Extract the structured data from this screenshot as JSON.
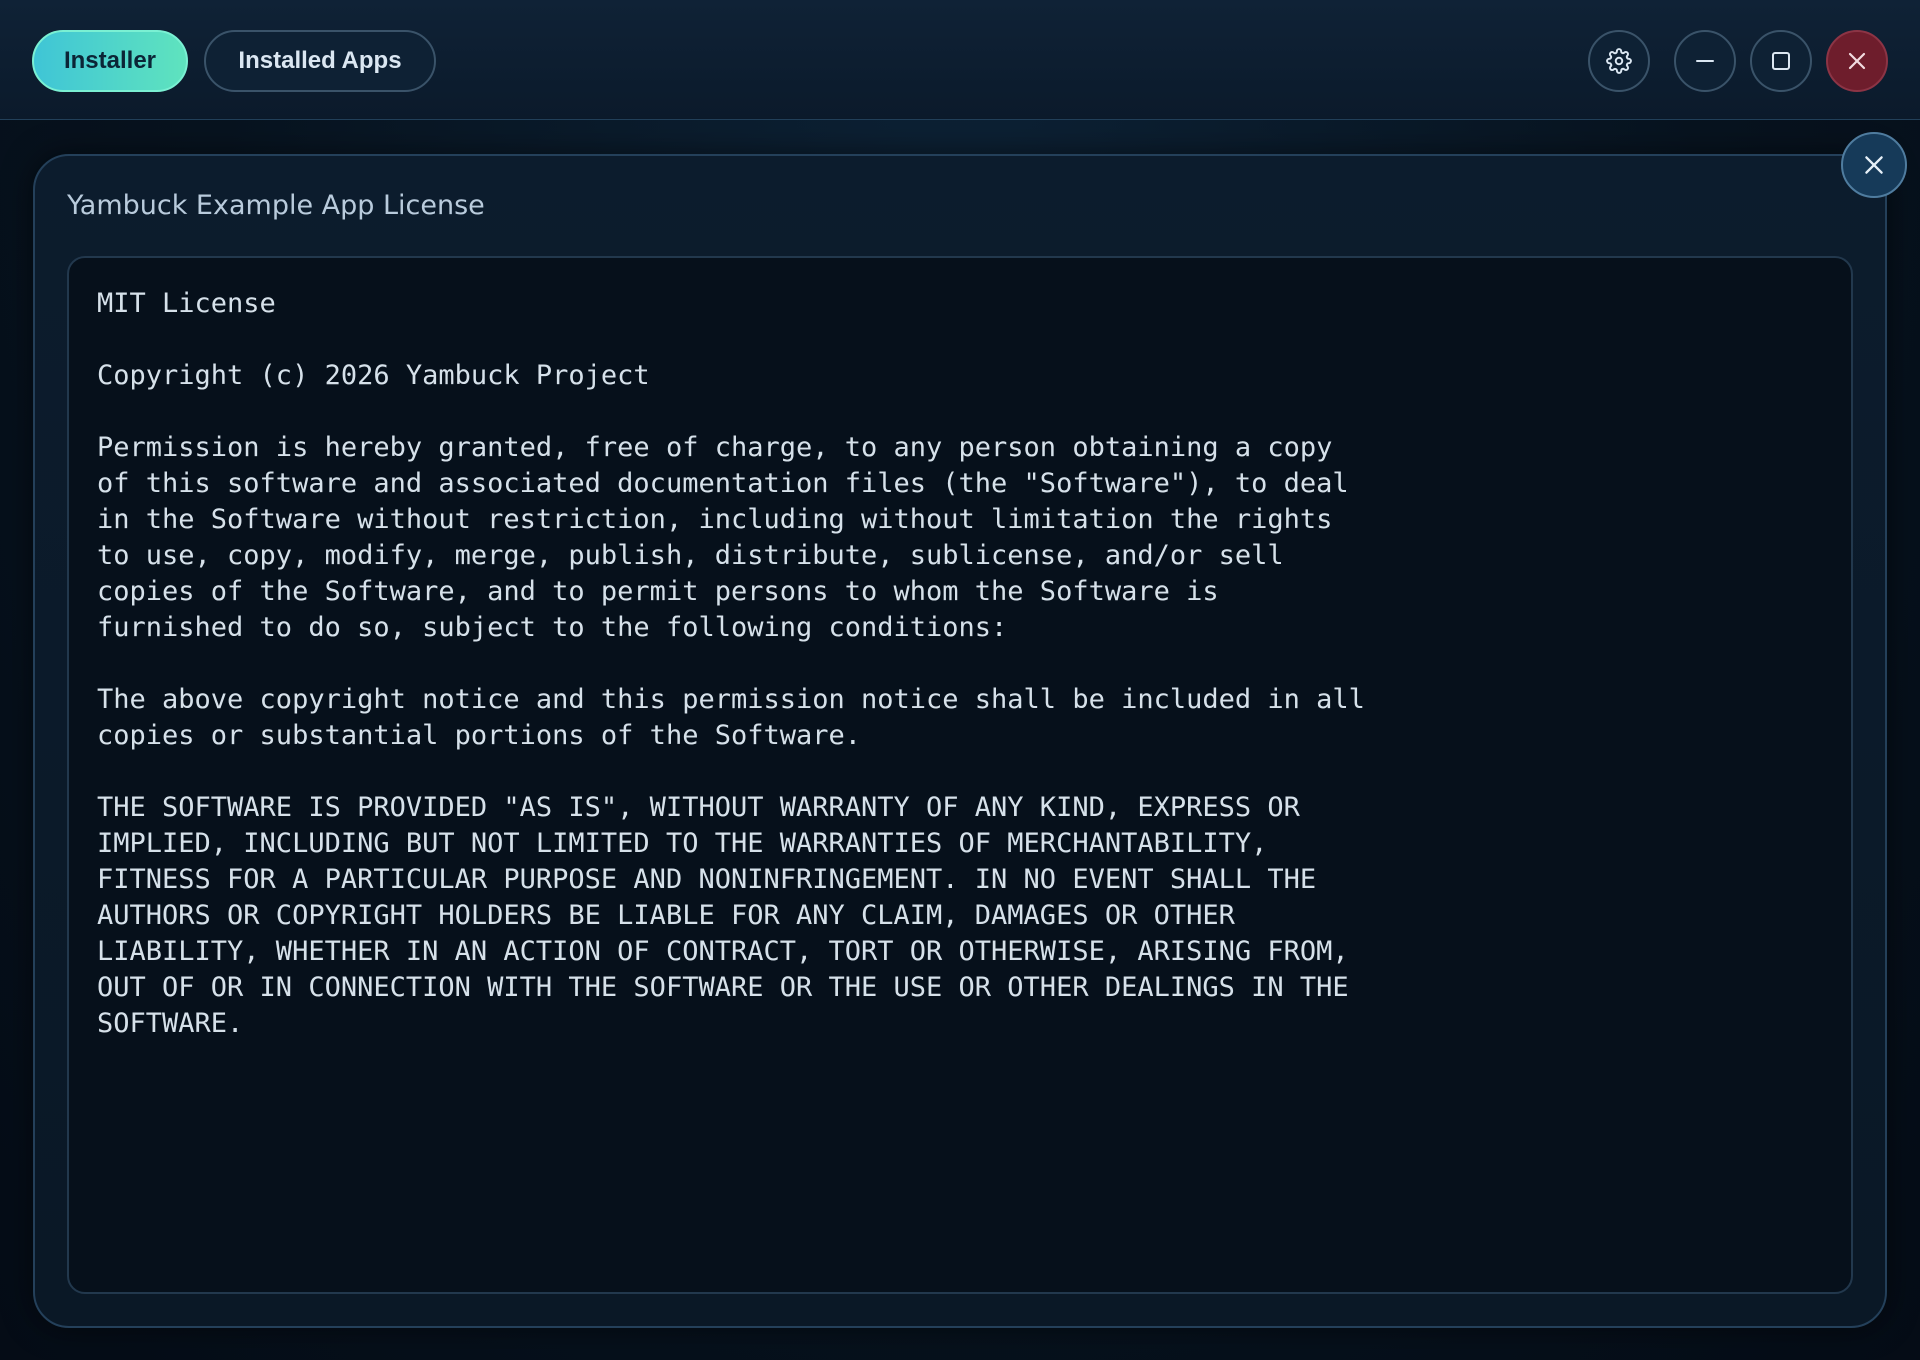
{
  "tabs": {
    "installer": "Installer",
    "installed_apps": "Installed Apps"
  },
  "window_controls": {
    "settings_icon": "gear-icon",
    "minimize_icon": "minus-icon",
    "maximize_icon": "square-icon",
    "close_icon": "close-icon"
  },
  "dialog": {
    "title": "Yambuck Example App License",
    "close_icon": "close-icon",
    "license_text": "MIT License\n\nCopyright (c) 2026 Yambuck Project\n\nPermission is hereby granted, free of charge, to any person obtaining a copy\nof this software and associated documentation files (the \"Software\"), to deal\nin the Software without restriction, including without limitation the rights\nto use, copy, modify, merge, publish, distribute, sublicense, and/or sell\ncopies of the Software, and to permit persons to whom the Software is\nfurnished to do so, subject to the following conditions:\n\nThe above copyright notice and this permission notice shall be included in all\ncopies or substantial portions of the Software.\n\nTHE SOFTWARE IS PROVIDED \"AS IS\", WITHOUT WARRANTY OF ANY KIND, EXPRESS OR\nIMPLIED, INCLUDING BUT NOT LIMITED TO THE WARRANTIES OF MERCHANTABILITY,\nFITNESS FOR A PARTICULAR PURPOSE AND NONINFRINGEMENT. IN NO EVENT SHALL THE\nAUTHORS OR COPYRIGHT HOLDERS BE LIABLE FOR ANY CLAIM, DAMAGES OR OTHER\nLIABILITY, WHETHER IN AN ACTION OF CONTRACT, TORT OR OTHERWISE, ARISING FROM,\nOUT OF OR IN CONNECTION WITH THE SOFTWARE OR THE USE OR OTHER DEALINGS IN THE\nSOFTWARE."
  },
  "colors": {
    "accent_start": "#3fc5d6",
    "accent_end": "#5fe3be",
    "close_red": "#6e1d2c",
    "dialog_close": "#163a59"
  }
}
